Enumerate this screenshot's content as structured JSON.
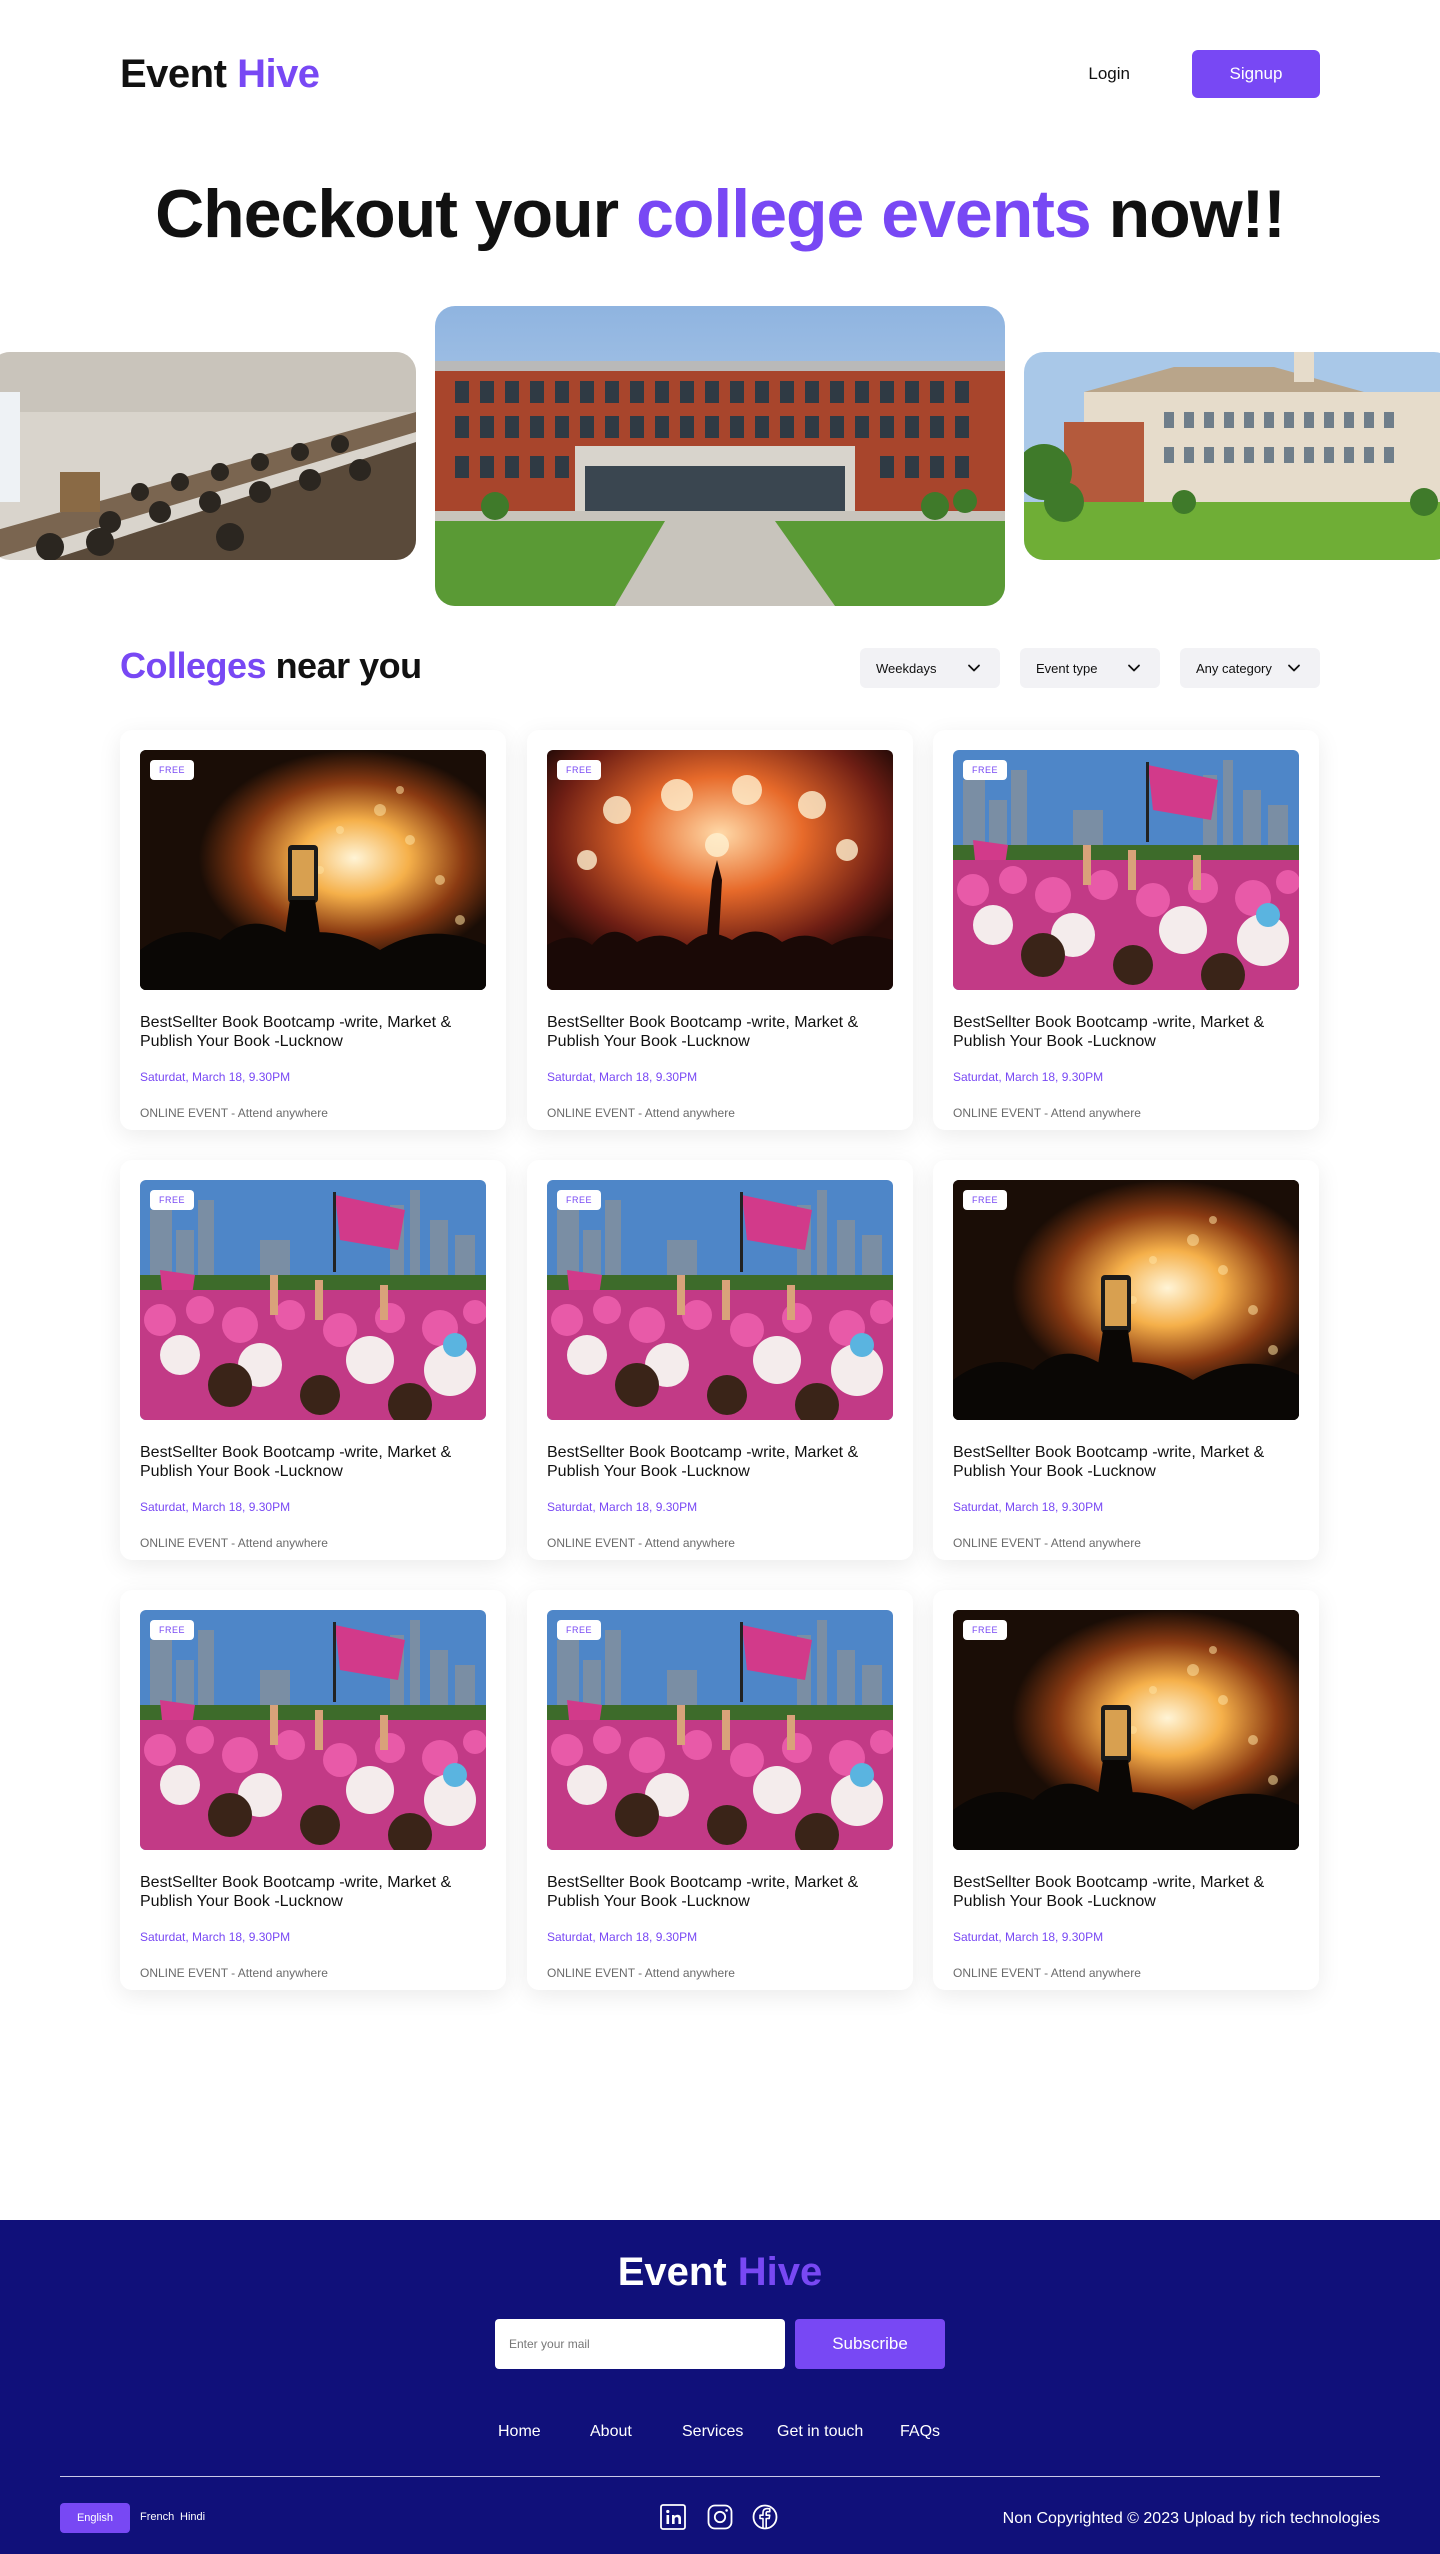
{
  "header": {
    "logo_main": "Event",
    "logo_accent": "Hive",
    "login_label": "Login",
    "signup_label": "Signup"
  },
  "hero": {
    "title_start": "Checkout your",
    "title_accent": "college events",
    "title_end": "now!!"
  },
  "section": {
    "title_accent": "Colleges",
    "title_rest": "near you",
    "filters": [
      "Weekdays",
      "Event type",
      "Any category"
    ]
  },
  "events": [
    {
      "badge": "FREE",
      "image": "bonfire-phone",
      "title": "BestSellter Book Bootcamp -write, Market & Publish Your Book -Lucknow",
      "date": "Saturdat, March 18, 9.30PM",
      "location": "ONLINE EVENT - Attend anywhere"
    },
    {
      "badge": "FREE",
      "image": "concert",
      "title": "BestSellter Book Bootcamp -write, Market & Publish Your Book -Lucknow",
      "date": "Saturdat, March 18, 9.30PM",
      "location": "ONLINE EVENT - Attend anywhere"
    },
    {
      "badge": "FREE",
      "image": "pink-crowd",
      "title": "BestSellter Book Bootcamp -write, Market & Publish Your Book -Lucknow",
      "date": "Saturdat, March 18, 9.30PM",
      "location": "ONLINE EVENT - Attend anywhere"
    },
    {
      "badge": "FREE",
      "image": "pink-crowd",
      "title": "BestSellter Book Bootcamp -write, Market & Publish Your Book -Lucknow",
      "date": "Saturdat, March 18, 9.30PM",
      "location": "ONLINE EVENT - Attend anywhere"
    },
    {
      "badge": "FREE",
      "image": "pink-crowd",
      "title": "BestSellter Book Bootcamp -write, Market & Publish Your Book -Lucknow",
      "date": "Saturdat, March 18, 9.30PM",
      "location": "ONLINE EVENT - Attend anywhere"
    },
    {
      "badge": "FREE",
      "image": "bonfire-phone",
      "title": "BestSellter Book Bootcamp -write, Market & Publish Your Book -Lucknow",
      "date": "Saturdat, March 18, 9.30PM",
      "location": "ONLINE EVENT - Attend anywhere"
    },
    {
      "badge": "FREE",
      "image": "pink-crowd",
      "title": "BestSellter Book Bootcamp -write, Market & Publish Your Book -Lucknow",
      "date": "Saturdat, March 18, 9.30PM",
      "location": "ONLINE EVENT - Attend anywhere"
    },
    {
      "badge": "FREE",
      "image": "pink-crowd",
      "title": "BestSellter Book Bootcamp -write, Market & Publish Your Book -Lucknow",
      "date": "Saturdat, March 18, 9.30PM",
      "location": "ONLINE EVENT - Attend anywhere"
    },
    {
      "badge": "FREE",
      "image": "bonfire-phone",
      "title": "BestSellter Book Bootcamp -write, Market & Publish Your Book -Lucknow",
      "date": "Saturdat, March 18, 9.30PM",
      "location": "ONLINE EVENT - Attend anywhere"
    }
  ],
  "footer": {
    "logo_main": "Event",
    "logo_accent": "Hive",
    "email_placeholder": "Enter your mail",
    "subscribe_label": "Subscribe",
    "nav": [
      "Home",
      "About",
      "Services",
      "Get in touch",
      "FAQs"
    ],
    "languages": [
      "English",
      "French",
      "Hindi"
    ],
    "social_icons": [
      "linkedin-icon",
      "instagram-icon",
      "facebook-icon"
    ],
    "copyright": "Non Copyrighted © 2023 Upload by rich technologies"
  },
  "colors": {
    "accent": "#7848f4",
    "footer_bg": "#10107a"
  }
}
